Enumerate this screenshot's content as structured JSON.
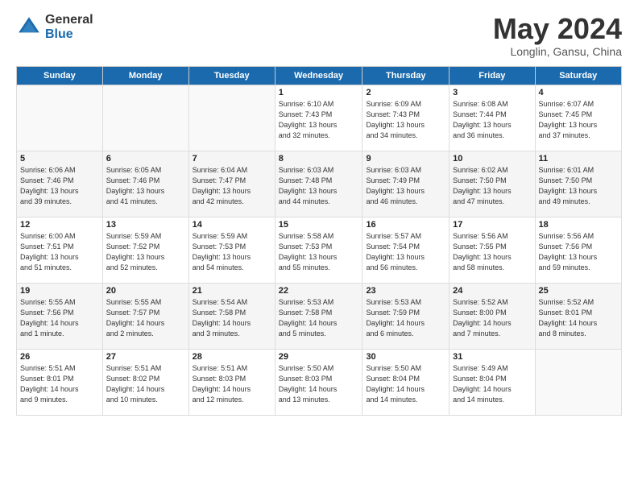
{
  "logo": {
    "general": "General",
    "blue": "Blue"
  },
  "title": {
    "month": "May 2024",
    "location": "Longlin, Gansu, China"
  },
  "weekdays": [
    "Sunday",
    "Monday",
    "Tuesday",
    "Wednesday",
    "Thursday",
    "Friday",
    "Saturday"
  ],
  "weeks": [
    [
      {
        "day": "",
        "detail": ""
      },
      {
        "day": "",
        "detail": ""
      },
      {
        "day": "",
        "detail": ""
      },
      {
        "day": "1",
        "detail": "Sunrise: 6:10 AM\nSunset: 7:43 PM\nDaylight: 13 hours\nand 32 minutes."
      },
      {
        "day": "2",
        "detail": "Sunrise: 6:09 AM\nSunset: 7:43 PM\nDaylight: 13 hours\nand 34 minutes."
      },
      {
        "day": "3",
        "detail": "Sunrise: 6:08 AM\nSunset: 7:44 PM\nDaylight: 13 hours\nand 36 minutes."
      },
      {
        "day": "4",
        "detail": "Sunrise: 6:07 AM\nSunset: 7:45 PM\nDaylight: 13 hours\nand 37 minutes."
      }
    ],
    [
      {
        "day": "5",
        "detail": "Sunrise: 6:06 AM\nSunset: 7:46 PM\nDaylight: 13 hours\nand 39 minutes."
      },
      {
        "day": "6",
        "detail": "Sunrise: 6:05 AM\nSunset: 7:46 PM\nDaylight: 13 hours\nand 41 minutes."
      },
      {
        "day": "7",
        "detail": "Sunrise: 6:04 AM\nSunset: 7:47 PM\nDaylight: 13 hours\nand 42 minutes."
      },
      {
        "day": "8",
        "detail": "Sunrise: 6:03 AM\nSunset: 7:48 PM\nDaylight: 13 hours\nand 44 minutes."
      },
      {
        "day": "9",
        "detail": "Sunrise: 6:03 AM\nSunset: 7:49 PM\nDaylight: 13 hours\nand 46 minutes."
      },
      {
        "day": "10",
        "detail": "Sunrise: 6:02 AM\nSunset: 7:50 PM\nDaylight: 13 hours\nand 47 minutes."
      },
      {
        "day": "11",
        "detail": "Sunrise: 6:01 AM\nSunset: 7:50 PM\nDaylight: 13 hours\nand 49 minutes."
      }
    ],
    [
      {
        "day": "12",
        "detail": "Sunrise: 6:00 AM\nSunset: 7:51 PM\nDaylight: 13 hours\nand 51 minutes."
      },
      {
        "day": "13",
        "detail": "Sunrise: 5:59 AM\nSunset: 7:52 PM\nDaylight: 13 hours\nand 52 minutes."
      },
      {
        "day": "14",
        "detail": "Sunrise: 5:59 AM\nSunset: 7:53 PM\nDaylight: 13 hours\nand 54 minutes."
      },
      {
        "day": "15",
        "detail": "Sunrise: 5:58 AM\nSunset: 7:53 PM\nDaylight: 13 hours\nand 55 minutes."
      },
      {
        "day": "16",
        "detail": "Sunrise: 5:57 AM\nSunset: 7:54 PM\nDaylight: 13 hours\nand 56 minutes."
      },
      {
        "day": "17",
        "detail": "Sunrise: 5:56 AM\nSunset: 7:55 PM\nDaylight: 13 hours\nand 58 minutes."
      },
      {
        "day": "18",
        "detail": "Sunrise: 5:56 AM\nSunset: 7:56 PM\nDaylight: 13 hours\nand 59 minutes."
      }
    ],
    [
      {
        "day": "19",
        "detail": "Sunrise: 5:55 AM\nSunset: 7:56 PM\nDaylight: 14 hours\nand 1 minute."
      },
      {
        "day": "20",
        "detail": "Sunrise: 5:55 AM\nSunset: 7:57 PM\nDaylight: 14 hours\nand 2 minutes."
      },
      {
        "day": "21",
        "detail": "Sunrise: 5:54 AM\nSunset: 7:58 PM\nDaylight: 14 hours\nand 3 minutes."
      },
      {
        "day": "22",
        "detail": "Sunrise: 5:53 AM\nSunset: 7:58 PM\nDaylight: 14 hours\nand 5 minutes."
      },
      {
        "day": "23",
        "detail": "Sunrise: 5:53 AM\nSunset: 7:59 PM\nDaylight: 14 hours\nand 6 minutes."
      },
      {
        "day": "24",
        "detail": "Sunrise: 5:52 AM\nSunset: 8:00 PM\nDaylight: 14 hours\nand 7 minutes."
      },
      {
        "day": "25",
        "detail": "Sunrise: 5:52 AM\nSunset: 8:01 PM\nDaylight: 14 hours\nand 8 minutes."
      }
    ],
    [
      {
        "day": "26",
        "detail": "Sunrise: 5:51 AM\nSunset: 8:01 PM\nDaylight: 14 hours\nand 9 minutes."
      },
      {
        "day": "27",
        "detail": "Sunrise: 5:51 AM\nSunset: 8:02 PM\nDaylight: 14 hours\nand 10 minutes."
      },
      {
        "day": "28",
        "detail": "Sunrise: 5:51 AM\nSunset: 8:03 PM\nDaylight: 14 hours\nand 12 minutes."
      },
      {
        "day": "29",
        "detail": "Sunrise: 5:50 AM\nSunset: 8:03 PM\nDaylight: 14 hours\nand 13 minutes."
      },
      {
        "day": "30",
        "detail": "Sunrise: 5:50 AM\nSunset: 8:04 PM\nDaylight: 14 hours\nand 14 minutes."
      },
      {
        "day": "31",
        "detail": "Sunrise: 5:49 AM\nSunset: 8:04 PM\nDaylight: 14 hours\nand 14 minutes."
      },
      {
        "day": "",
        "detail": ""
      }
    ]
  ]
}
